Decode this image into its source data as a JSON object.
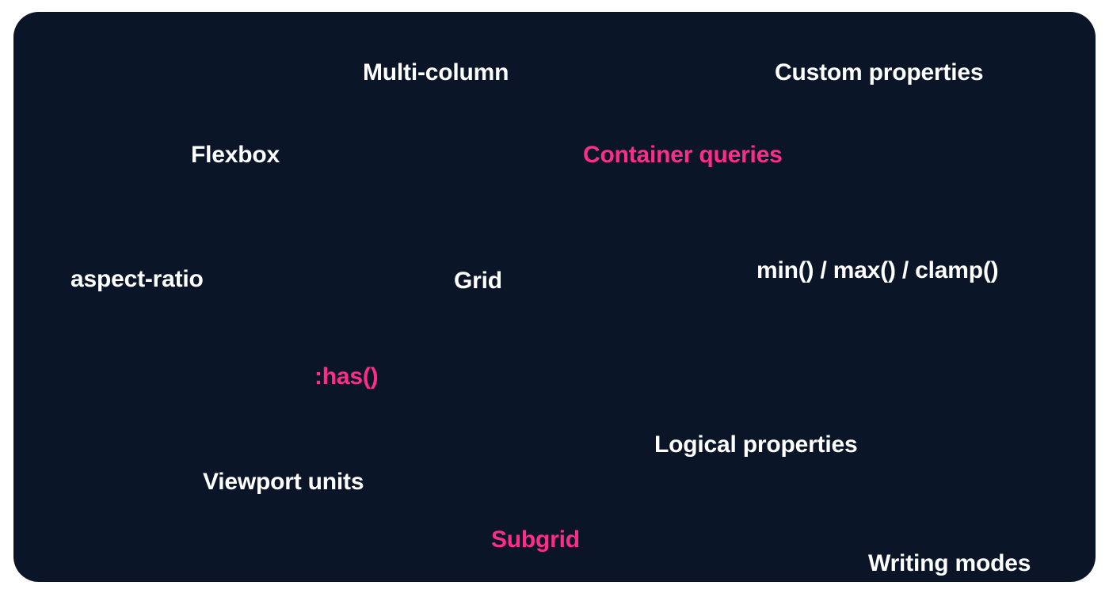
{
  "colors": {
    "background": "#0a1628",
    "text": "#ffffff",
    "accent": "#ff2d8a"
  },
  "terms": {
    "multi_column": "Multi-column",
    "custom_properties": "Custom properties",
    "flexbox": "Flexbox",
    "container_queries": "Container queries",
    "aspect_ratio": "aspect-ratio",
    "grid": "Grid",
    "min_max_clamp": "min() / max() / clamp()",
    "has": ":has()",
    "logical_properties": "Logical properties",
    "viewport_units": "Viewport units",
    "subgrid": "Subgrid",
    "writing_modes": "Writing modes"
  }
}
